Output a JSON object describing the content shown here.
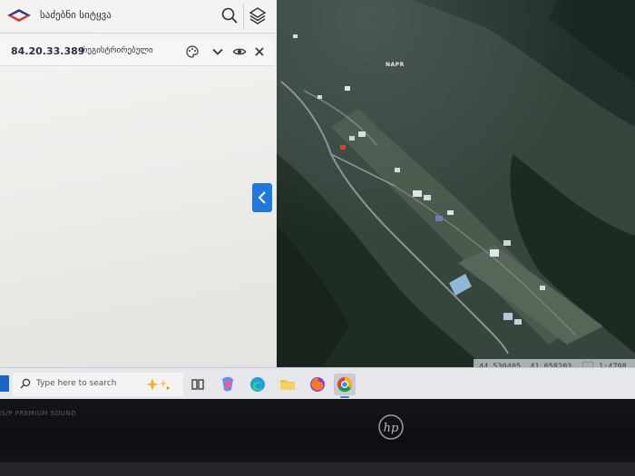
{
  "app": {
    "title": "საძებნი სიტყვა"
  },
  "parcel": {
    "code": "84.20.33.389",
    "status": "-რეგისტრირებული"
  },
  "icons": {
    "search": "search-icon",
    "layers": "layers-icon",
    "palette": "palette-icon",
    "chevron": "chevron-down-icon",
    "eye": "eye-icon",
    "close": "close-icon",
    "collapse": "chevron-left-icon"
  },
  "map": {
    "label": "NAPR",
    "coordinates": "44.530405, 41.658203",
    "scale": "1:4798"
  },
  "taskbar": {
    "search_placeholder": "Type here to search"
  },
  "bezel": {
    "brand_text": "SIS/P PREMIUM SOUND"
  },
  "colors": {
    "accent": "#1f79d8",
    "parcel_text": "#2b2f4a",
    "logo_blue": "#2a3a8c",
    "logo_red": "#d23a2a"
  }
}
